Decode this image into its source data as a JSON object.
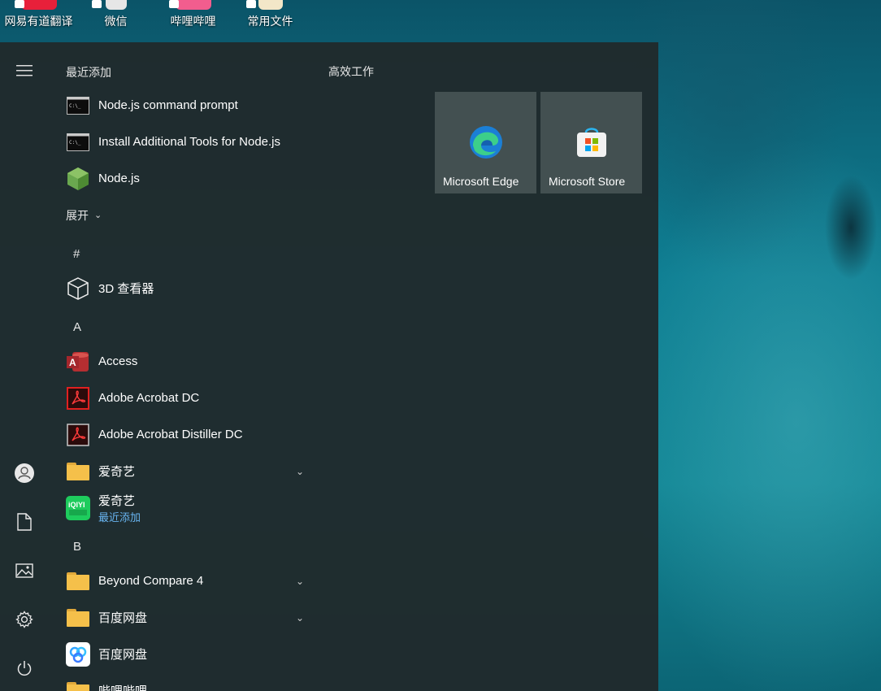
{
  "desktop": {
    "icons": [
      {
        "label": "网易有道翻译"
      },
      {
        "label": "微信"
      },
      {
        "label": "哔哩哔哩"
      },
      {
        "label": "常用文件"
      }
    ]
  },
  "start_menu": {
    "recent_title": "最近添加",
    "recent": [
      {
        "label": "Node.js command prompt",
        "icon": "terminal-icon"
      },
      {
        "label": "Install Additional Tools for Node.js",
        "icon": "terminal-icon"
      },
      {
        "label": "Node.js",
        "icon": "nodejs-icon"
      }
    ],
    "expand_label": "展开",
    "sections": [
      {
        "letter": "#"
      },
      {
        "letter": "A"
      },
      {
        "letter": "B"
      }
    ],
    "apps": [
      {
        "label": "3D 查看器",
        "icon": "cube-icon"
      },
      {
        "label": "Access",
        "icon": "access-icon"
      },
      {
        "label": "Adobe Acrobat DC",
        "icon": "acrobat-icon"
      },
      {
        "label": "Adobe Acrobat Distiller DC",
        "icon": "acrobat-distiller-icon"
      },
      {
        "label": "爱奇艺",
        "icon": "folder-icon"
      },
      {
        "label": "爱奇艺",
        "sub": "最近添加",
        "icon": "iqiyi-icon"
      },
      {
        "label": "Beyond Compare 4",
        "icon": "folder-icon"
      },
      {
        "label": "百度网盘",
        "icon": "folder-icon"
      },
      {
        "label": "百度网盘",
        "icon": "baidu-netdisk-icon"
      },
      {
        "label": "哔哩哔哩",
        "icon": "folder-icon"
      }
    ],
    "tiles_title": "高效工作",
    "tiles": [
      {
        "label": "Microsoft Edge",
        "icon": "edge-icon"
      },
      {
        "label": "Microsoft Store",
        "icon": "store-icon"
      }
    ]
  }
}
